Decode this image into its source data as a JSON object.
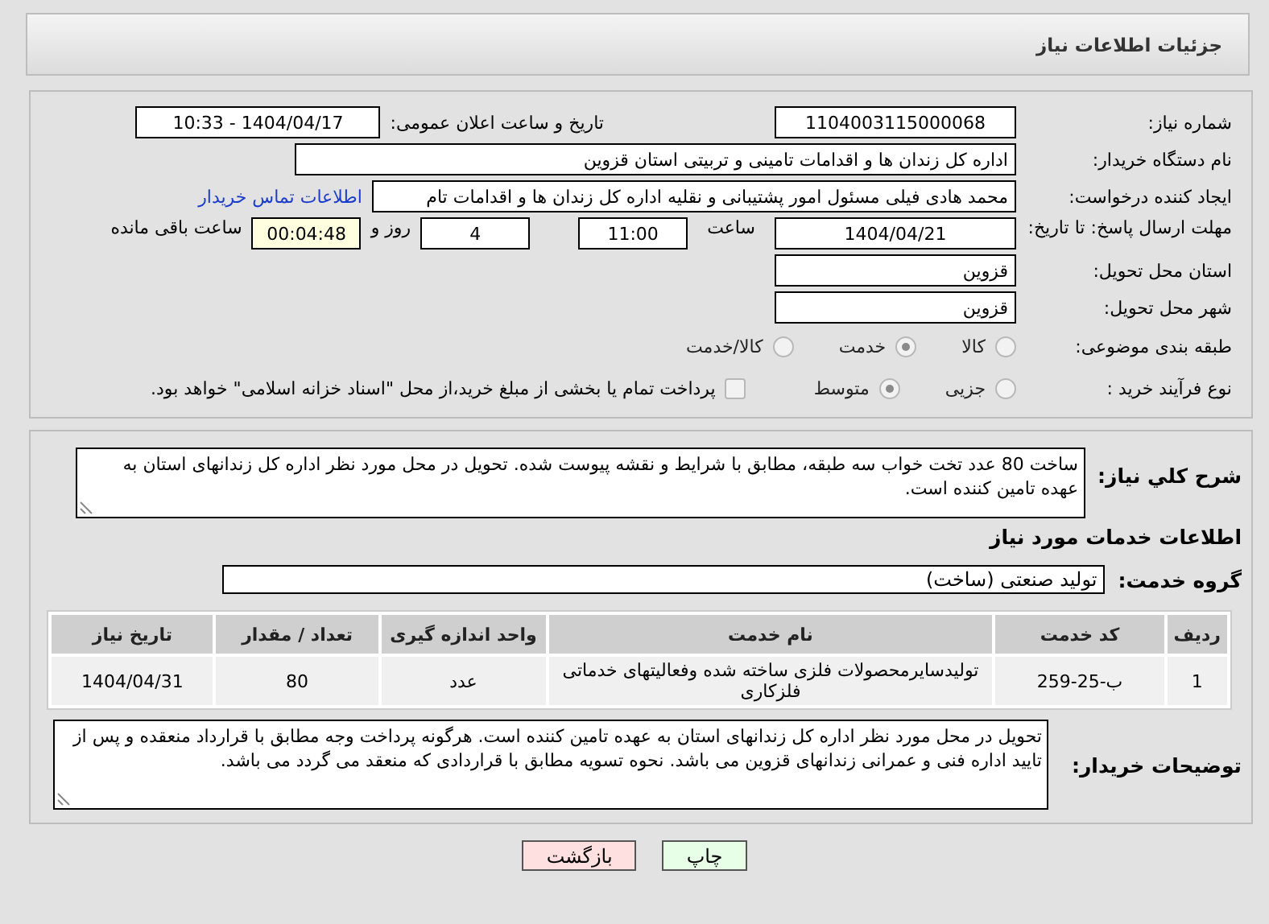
{
  "page_title": "جزئیات اطلاعات نیاز",
  "request_info": {
    "need_number": {
      "label": "شماره نیاز:",
      "value": "1104003115000068"
    },
    "announce_datetime": {
      "label": "تاریخ و ساعت اعلان عمومی:",
      "value": "1404/04/17 - 10:33"
    },
    "buyer_org": {
      "label": "نام دستگاه خریدار:",
      "value": "اداره کل زندان ها و اقدامات تامینی و تربیتی استان قزوین"
    },
    "creator": {
      "label": "ایجاد کننده درخواست:",
      "value": "محمد هادی فیلی مسئول امور پشتیبانی و نقلیه اداره کل زندان ها و اقدامات تام",
      "link": "اطلاعات تماس خریدار"
    },
    "deadline": {
      "label": "مهلت ارسال پاسخ: تا تاریخ:",
      "date": "1404/04/21",
      "time_label": "ساعت",
      "time": "11:00",
      "days": "4",
      "days_label": "روز و",
      "remaining": "00:04:48",
      "remaining_label": "ساعت باقی مانده"
    },
    "province": {
      "label": "استان محل تحویل:",
      "value": "قزوین"
    },
    "city": {
      "label": "شهر محل تحویل:",
      "value": "قزوین"
    },
    "category": {
      "label": "طبقه بندی موضوعی:",
      "options": [
        {
          "label": "کالا",
          "selected": false
        },
        {
          "label": "خدمت",
          "selected": true
        },
        {
          "label": "کالا/خدمت",
          "selected": false
        }
      ]
    },
    "process": {
      "label": "نوع فرآیند خرید :",
      "options": [
        {
          "label": "جزیی",
          "selected": false
        },
        {
          "label": "متوسط",
          "selected": true
        }
      ],
      "treasury": {
        "checked": false,
        "text": "پرداخت تمام یا بخشی از مبلغ خرید،از محل \"اسناد خزانه اسلامی\" خواهد بود."
      }
    }
  },
  "needs": {
    "description": {
      "label": "شرح کلي نياز:",
      "value": "ساخت 80 عدد تخت خواب سه طبقه، مطابق با شرایط و نقشه پیوست شده. تحویل در محل مورد نظر اداره کل زندانهای استان به عهده تامین کننده است."
    },
    "services_heading": "اطلاعات خدمات مورد نیاز",
    "service_group": {
      "label": "گروه خدمت:",
      "value": "تولید صنعتی (ساخت)"
    },
    "table": {
      "columns": [
        "ردیف",
        "کد خدمت",
        "نام خدمت",
        "واحد اندازه گیری",
        "تعداد / مقدار",
        "تاریخ نیاز"
      ],
      "rows": [
        [
          "1",
          "ب-25-259",
          "تولیدسایرمحصولات فلزی ساخته شده وفعالیتهای خدماتی فلزکاری",
          "عدد",
          "80",
          "1404/04/31"
        ]
      ]
    },
    "buyer_notes": {
      "label": "توضیحات خریدار:",
      "value": "تحویل در محل مورد نظر اداره کل زندانهای استان به عهده تامین کننده است. هرگونه پرداخت وجه مطابق با قرارداد منعقده و پس از تایید اداره فنی و عمرانی زندانهای قزوین می باشد. نحوه تسویه مطابق با قراردادی که منعقد می گردد می باشد."
    }
  },
  "buttons": [
    {
      "label": "چاپ",
      "kind": "print"
    },
    {
      "label": "بازگشت",
      "kind": "back"
    }
  ]
}
